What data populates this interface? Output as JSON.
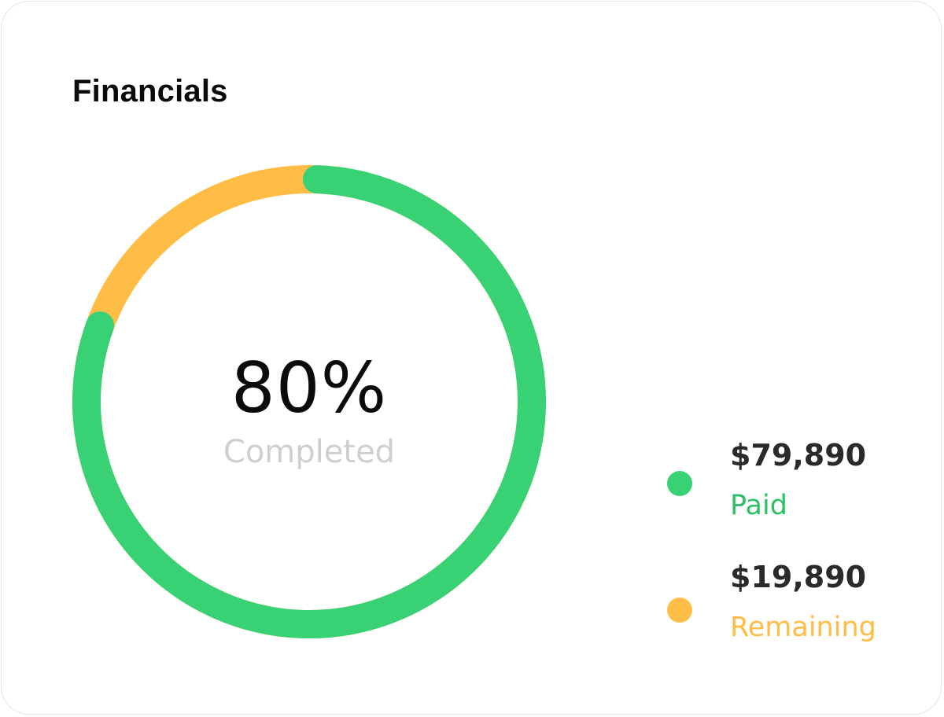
{
  "card": {
    "title": "Financials"
  },
  "chart_data": {
    "type": "pie",
    "style": "donut",
    "center_value": "80%",
    "center_label": "Completed",
    "completed_fraction": 0.8,
    "series": [
      {
        "name": "Paid",
        "amount": "$79,890",
        "value": 79890,
        "color": "#38d275"
      },
      {
        "name": "Remaining",
        "amount": "$19,890",
        "value": 19890,
        "color": "#ffbd45"
      }
    ]
  }
}
